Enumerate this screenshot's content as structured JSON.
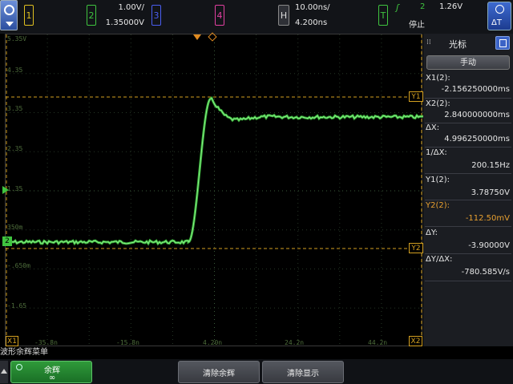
{
  "topbar": {
    "ch1": {
      "label": "1",
      "color": "#e0c020"
    },
    "ch2": {
      "label": "2",
      "scale": "1.00V/",
      "offset": "1.35000V",
      "color": "#3fc43f"
    },
    "ch3": {
      "label": "3",
      "color": "#4a5ef0"
    },
    "ch4": {
      "label": "4",
      "color": "#e040a0"
    },
    "horizontal": {
      "label": "H",
      "timebase": "10.00ns/",
      "delay": "4.200ns"
    },
    "trigger": {
      "label": "T",
      "source": "2",
      "level": "1.26V",
      "status": "停止",
      "color": "#3fc43f"
    }
  },
  "screen": {
    "y_labels": [
      "5.35V",
      "4.35",
      "3.35",
      "2.35",
      "1.35",
      "350m",
      "-.650m",
      "-1.65"
    ],
    "x_labels": [
      "-35.8n",
      "-15.8n",
      "4.20n",
      "24.2n",
      "44.2n"
    ],
    "cursor_tags": {
      "y1": "Y1",
      "y2": "Y2",
      "x1": "X1",
      "x2": "X2"
    },
    "marker_2": "2",
    "trace_color": "#3fc43f",
    "cursor_color": "#d4a020"
  },
  "panel": {
    "title": "光标",
    "mode_button": "手动",
    "x1_label": "X1(2):",
    "x1_value": "-2.156250000ms",
    "x2_label": "X2(2):",
    "x2_value": "2.840000000ms",
    "dx_label": "ΔX:",
    "dx_value": "4.996250000ms",
    "inv_dx_label": "1/ΔX:",
    "inv_dx_value": "200.15Hz",
    "y1_label": "Y1(2):",
    "y1_value": "3.78750V",
    "y2_label": "Y2(2):",
    "y2_value": "-112.50mV",
    "dy_label": "ΔY:",
    "dy_value": "-3.90000V",
    "dydx_label": "ΔY/ΔX:",
    "dydx_value": "-780.585V/s"
  },
  "menu": {
    "title": "波形余辉菜单",
    "persistence_label": "余辉",
    "persistence_value": "∞",
    "clear_persistence": "清除余辉",
    "clear_display": "清除显示"
  }
}
